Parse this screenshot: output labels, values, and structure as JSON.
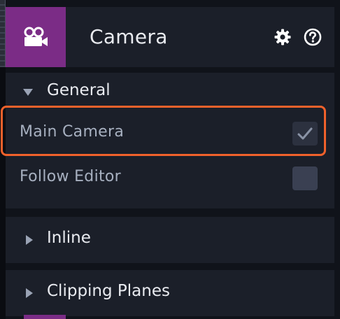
{
  "component": {
    "title": "Camera",
    "icon": "camera-icon",
    "accent_color": "#7b2c86"
  },
  "toolbar": {
    "settings_icon": "gear-icon",
    "help_icon": "help-icon"
  },
  "sections": [
    {
      "label": "General",
      "expanded": true,
      "properties": [
        {
          "label": "Main Camera",
          "checked": true
        },
        {
          "label": "Follow Editor",
          "checked": false
        }
      ]
    },
    {
      "label": "Inline",
      "expanded": false
    },
    {
      "label": "Clipping Planes",
      "expanded": false
    }
  ],
  "highlight_color": "#f0612b"
}
